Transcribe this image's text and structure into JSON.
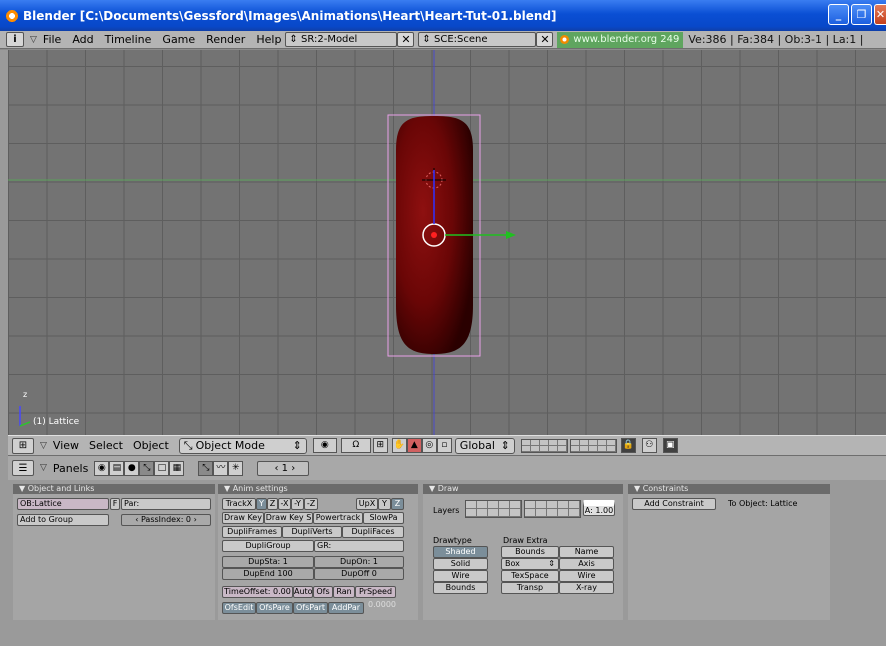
{
  "window": {
    "title": "Blender [C:\\Documents\\Gessford\\Images\\Animations\\Heart\\Heart-Tut-01.blend]"
  },
  "main_header": {
    "menus": [
      "File",
      "Add",
      "Timeline",
      "Game",
      "Render",
      "Help"
    ],
    "screen": "SR:2-Model",
    "scene": "SCE:Scene",
    "website": "www.blender.org 249",
    "stats": "Ve:386 | Fa:384 | Ob:3-1 | La:1 |"
  },
  "viewport": {
    "object_label": "(1) Lattice",
    "axis_z": "z",
    "colors": {
      "background": "#737373",
      "object": "#7a0a0a",
      "lattice": "#e8a0e8"
    }
  },
  "view3d_header": {
    "menus": [
      "View",
      "Select",
      "Object"
    ],
    "mode": "Object Mode",
    "orientation": "Global"
  },
  "buttons_header": {
    "panels_label": "Panels",
    "frame": "1"
  },
  "object_panel": {
    "title": "Object and Links",
    "ob_name": "OB:Lattice",
    "f_label": "F",
    "par_label": "Par:",
    "add_group": "Add to Group",
    "pass_index": "PassIndex: 0"
  },
  "anim_panel": {
    "title": "Anim settings",
    "track": [
      "TrackX",
      "Y",
      "Z",
      "-X",
      "-Y",
      "-Z"
    ],
    "up": [
      "UpX",
      "Y",
      "Z"
    ],
    "row2": [
      "Draw Key",
      "Draw Key S",
      "Powertrack",
      "SlowPa"
    ],
    "row3": [
      "DupliFrames",
      "DupliVerts",
      "DupliFaces"
    ],
    "dupli_group": "DupliGroup",
    "gr": "GR:",
    "dup_sta": "DupSta: 1",
    "dup_on": "DupOn: 1",
    "dup_end": "DupEnd 100",
    "dup_off": "DupOff 0",
    "time_offset": "TimeOffset: 0.00",
    "row_offset": [
      "Auto",
      "Ofs",
      "Ran",
      "PrSpeed"
    ],
    "row_last": [
      "OfsEdit",
      "OfsPare",
      "OfsPart",
      "AddPar"
    ],
    "value": "0.0000"
  },
  "draw_panel": {
    "title": "Draw",
    "layers_label": "Layers",
    "a_value": "A: 1.00",
    "drawtype_label": "Drawtype",
    "drawextra_label": "Draw Extra",
    "drawtypes": [
      "Shaded",
      "Solid",
      "Wire",
      "Bounds"
    ],
    "extra": [
      [
        "Bounds",
        "Name"
      ],
      [
        "Box",
        "Axis"
      ],
      [
        "TexSpace",
        "Wire"
      ],
      [
        "Transp",
        "X-ray"
      ]
    ]
  },
  "constraints_panel": {
    "title": "Constraints",
    "add_constraint": "Add Constraint",
    "to_object": "To Object: Lattice"
  }
}
